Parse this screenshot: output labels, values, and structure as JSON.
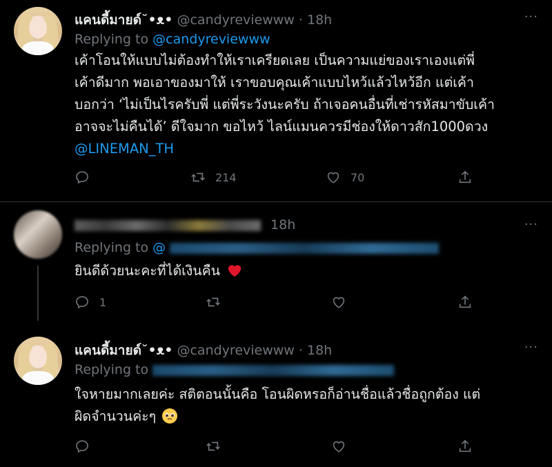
{
  "tweets": [
    {
      "name": "แคนดี้มายด์˘•ᴥ•",
      "handle": "@candyreviewww",
      "dot": "·",
      "time": "18h",
      "reply_prefix": "Replying to",
      "reply_to": "@candyreviewww",
      "body_lines": [
        "เค้าโอนให้แบบไม่ต้องทำให้เราเครียดเลย เป็นความแย่ของเราเองแต่พี่",
        "เค้าดีมาก พอเอาของมาให้ เราขอบคุณเค้าแบบไหว้แล้วไหว้อีก แต่เค้า",
        "บอกว่า ‘ไม่เป็นไรครับพี่ แต่พี่ระวังนะครับ ถ้าเจอคนอื่นที่เช่ารหัสมาขับเค้า",
        "อาจจะไม่คืนได้’ ดีใจมาก ขอไหว้ ไลน์แมนควรมีช่องให้ดาวสัก1000ดวง"
      ],
      "mention": "@LINEMAN_TH",
      "retweets": "214",
      "likes": "70"
    },
    {
      "time": "18h",
      "reply_prefix": "Replying to",
      "reply_to": "@",
      "body": "ยินดีด้วยนะคะที่ได้เงินคืน",
      "replies": "1"
    },
    {
      "name": "แคนดี้มายด์˘•ᴥ•",
      "handle": "@candyreviewww",
      "dot": "·",
      "time": "18h",
      "reply_prefix": "Replying to",
      "body_lines": [
        "ใจหายมากเลยค่ะ สติตอนนั้นคือ โอนผิดหรอก็อ่านชื่อแล้วชื่อถูกต้อง แต่",
        "ผิดจำนวนค่ะๆ"
      ]
    }
  ],
  "more_label": "···",
  "colors": {
    "accent": "#1d9bf0",
    "muted": "#71767b",
    "heart": "#f91880"
  }
}
